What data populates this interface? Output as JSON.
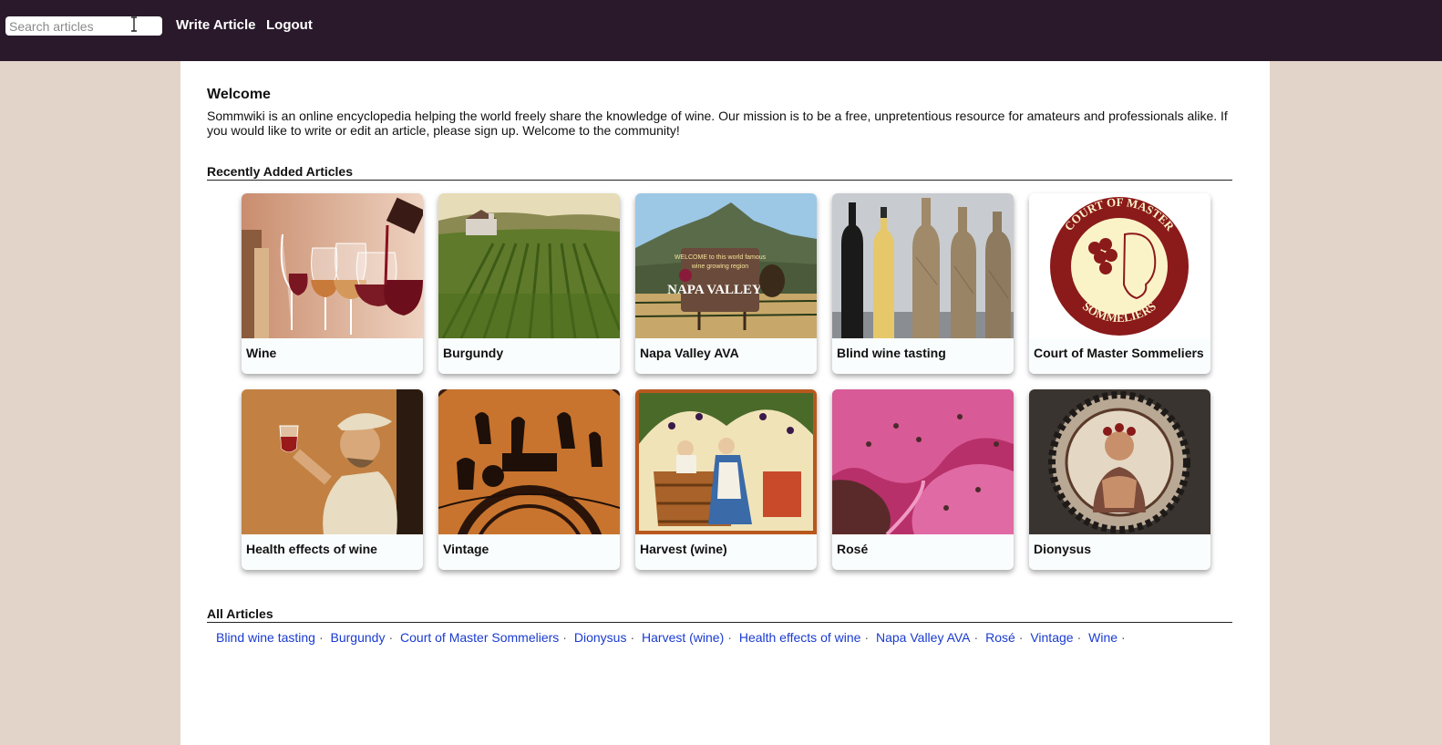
{
  "nav": {
    "search_placeholder": "Search articles",
    "write_label": "Write Article",
    "logout_label": "Logout"
  },
  "welcome": {
    "title": "Welcome",
    "text": "Sommwiki is an online encyclopedia helping the world freely share the knowledge of wine. Our mission is to be a free, unpretentious resource for amateurs and professionals alike. If you would like to write or edit an article, please sign up. Welcome to the community!"
  },
  "recent": {
    "title": "Recently Added Articles",
    "articles": [
      {
        "title": "Wine",
        "image": "wine-glasses-pour"
      },
      {
        "title": "Burgundy",
        "image": "vineyard-landscape"
      },
      {
        "title": "Napa Valley AVA",
        "image": "napa-sign",
        "sign_line1": "WELCOME to this world famous",
        "sign_line2": "wine growing region",
        "sign_main": "NAPA VALLEY"
      },
      {
        "title": "Blind wine tasting",
        "image": "wrapped-bottles"
      },
      {
        "title": "Court of Master Sommeliers",
        "image": "court-seal",
        "seal_top": "COURT OF MASTER",
        "seal_bottom": "SOMMELIERS"
      },
      {
        "title": "Health effects of wine",
        "image": "painting-man-glass"
      },
      {
        "title": "Vintage",
        "image": "greek-vase"
      },
      {
        "title": "Harvest (wine)",
        "image": "medieval-harvest"
      },
      {
        "title": "Rosé",
        "image": "pink-must"
      },
      {
        "title": "Dionysus",
        "image": "mosaic-dionysus"
      }
    ]
  },
  "all": {
    "title": "All Articles",
    "separator": "·",
    "links": [
      "Blind wine tasting",
      "Burgundy",
      "Court of Master Sommeliers",
      "Dionysus",
      "Harvest (wine)",
      "Health effects of wine",
      "Napa Valley AVA",
      "Rosé",
      "Vintage",
      "Wine"
    ]
  },
  "colors": {
    "topbar": "#29192b",
    "page_bg": "#e3d4c9",
    "link": "#1a3bd0"
  }
}
